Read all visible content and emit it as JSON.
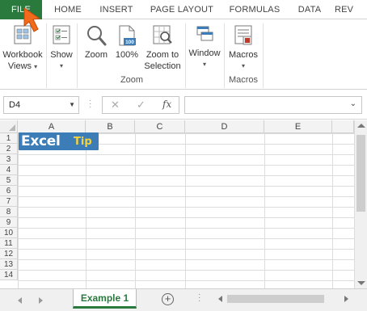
{
  "tabs": [
    {
      "label": "FILE"
    },
    {
      "label": "HOME"
    },
    {
      "label": "INSERT"
    },
    {
      "label": "PAGE LAYOUT"
    },
    {
      "label": "FORMULAS"
    },
    {
      "label": "DATA"
    },
    {
      "label": "REV"
    }
  ],
  "ribbon": {
    "workbook_views_line1": "Workbook",
    "workbook_views_line2": "Views",
    "show": "Show",
    "zoom": "Zoom",
    "zoom100": "100%",
    "zoom_sel_line1": "Zoom to",
    "zoom_sel_line2": "Selection",
    "zoom_group": "Zoom",
    "window": "Window",
    "macros": "Macros",
    "macros_group": "Macros",
    "hundred_badge": "100"
  },
  "formula_bar": {
    "name_box": "D4",
    "cancel_icon": "✕",
    "enter_icon": "✓",
    "fx_label": "fx",
    "formula_value": ""
  },
  "columns": [
    "A",
    "B",
    "C",
    "D",
    "E"
  ],
  "rows": [
    "1",
    "2",
    "3",
    "4",
    "5",
    "6",
    "7",
    "8",
    "9",
    "10",
    "11",
    "12",
    "13",
    "14"
  ],
  "logo": {
    "excel": "Excel",
    "tip": "Tip"
  },
  "sheets": [
    {
      "label": "Example 1",
      "active": true
    }
  ],
  "colors": {
    "accent": "#2a7a3e",
    "logo_bg": "#3d7db7",
    "logo_tip": "#f5d33a",
    "arrow": "#f26a1b"
  },
  "icons": [
    "workbook-views-icon",
    "show-icon",
    "zoom-magnifier-icon",
    "zoom-100-icon",
    "zoom-selection-icon",
    "window-icon",
    "macros-icon"
  ]
}
